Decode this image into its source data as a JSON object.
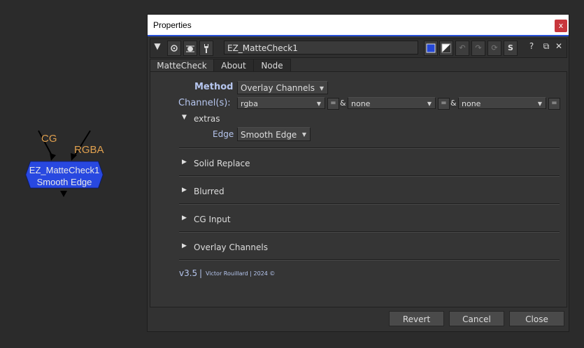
{
  "node_graph": {
    "inputs": [
      "CG",
      "RGBA"
    ],
    "node": {
      "name": "EZ_MatteCheck1",
      "subtitle": "Smooth Edge",
      "color": "#2848e0"
    }
  },
  "window": {
    "title": "Properties",
    "close_label": "x",
    "node_name": "EZ_MatteCheck1",
    "toolbar": {
      "collapse_icon": "▼",
      "help_label": "?",
      "float_label": "⧉",
      "close_label": "✕",
      "s_label": "S"
    },
    "tabs": [
      {
        "label": "MatteCheck",
        "active": true
      },
      {
        "label": "About"
      },
      {
        "label": "Node"
      }
    ],
    "knobs": {
      "method_label": "Method",
      "method_value": "Overlay Channels",
      "channels_label": "Channel(s):",
      "channel_1": "rgba",
      "channel_2": "none",
      "channel_3": "none",
      "eq": "=",
      "amp": "&",
      "extras_label": "extras",
      "edge_label": "Edge",
      "edge_value": "Smooth Edge"
    },
    "sections": [
      "Solid Replace",
      "Blurred",
      "CG Input",
      "Overlay Channels"
    ],
    "version": "v3.5",
    "separator": "|",
    "credit": "Victor Rouillard | 2024 ©",
    "buttons": {
      "revert": "Revert",
      "cancel": "Cancel",
      "close": "Close"
    }
  }
}
